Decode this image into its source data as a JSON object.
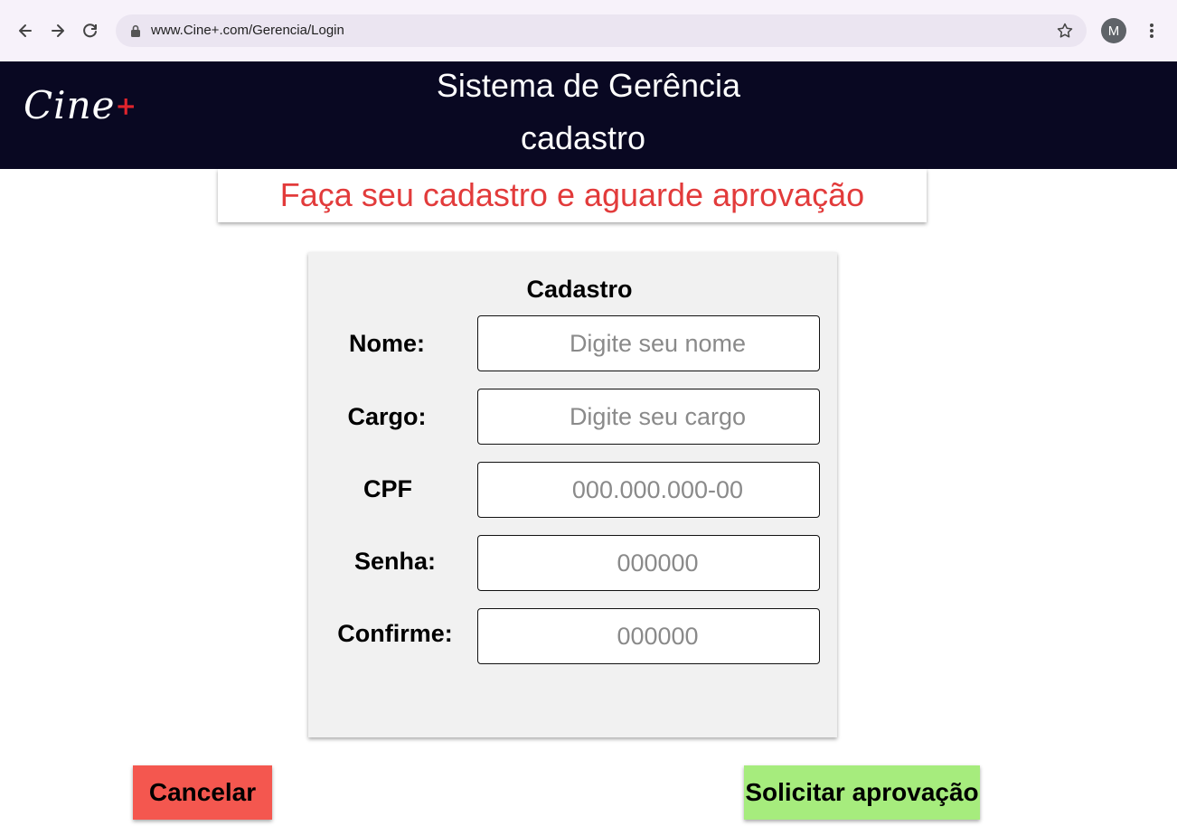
{
  "browser": {
    "url": "www.Cine+.com/Gerencia/Login",
    "profile_initial": "M"
  },
  "header": {
    "logo_text": "Cine",
    "logo_plus": "+",
    "title_line1": "Sistema de Gerência",
    "title_line2": "cadastro"
  },
  "banner": {
    "text": "Faça seu cadastro e aguarde aprovação"
  },
  "form": {
    "title": "Cadastro",
    "fields": [
      {
        "label": "Nome:",
        "placeholder": "Digite seu nome"
      },
      {
        "label": "Cargo:",
        "placeholder": "Digite seu cargo"
      },
      {
        "label": "CPF",
        "placeholder": "000.000.000-00"
      },
      {
        "label": "Senha:",
        "placeholder": "000000"
      },
      {
        "label": "Confirme:",
        "placeholder": "000000"
      }
    ]
  },
  "actions": {
    "cancel_label": "Cancelar",
    "submit_label": "Solicitar aprovação"
  },
  "colors": {
    "header_bg": "#090822",
    "banner_text": "#e23b3b",
    "cancel_bg": "#f4574f",
    "submit_bg": "#a6ec7d",
    "card_bg": "#f1f1f1"
  }
}
